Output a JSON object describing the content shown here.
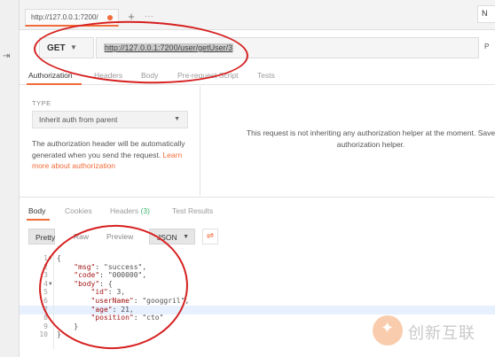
{
  "tabs": {
    "request_tab_label": "http://127.0.0.1:7200/",
    "new_tab": "+",
    "more": "···",
    "env_label": "N"
  },
  "request": {
    "method": "GET",
    "url": "http://127.0.0.1:7200/user/getUser/3",
    "params_label": "P"
  },
  "request_tabs": [
    "Authorization",
    "Headers",
    "Body",
    "Pre-request Script",
    "Tests"
  ],
  "auth": {
    "type_label": "TYPE",
    "type_value": "Inherit auth from parent",
    "description": "The authorization header will be automatically generated when you send the request. ",
    "learn_more": "Learn more about authorization",
    "message": "This request is not inheriting any authorization helper at the moment. Save authorization helper."
  },
  "response_tabs": {
    "body": "Body",
    "cookies": "Cookies",
    "headers": "Headers",
    "headers_count": "(3)",
    "test_results": "Test Results"
  },
  "view_modes": {
    "pretty": "Pretty",
    "raw": "Raw",
    "preview": "Preview",
    "format": "JSON"
  },
  "response_lines": [
    {
      "n": "1",
      "fold": true,
      "text": "{"
    },
    {
      "n": "2",
      "fold": false,
      "text": "    \"msg\": \"success\","
    },
    {
      "n": "3",
      "fold": false,
      "text": "    \"code\": \"000000\","
    },
    {
      "n": "4",
      "fold": true,
      "text": "    \"body\": {"
    },
    {
      "n": "5",
      "fold": false,
      "text": "        \"id\": 3,"
    },
    {
      "n": "6",
      "fold": false,
      "text": "        \"userName\": \"googgril\","
    },
    {
      "n": "7",
      "fold": false,
      "text": "        \"age\": 21,"
    },
    {
      "n": "8",
      "fold": false,
      "text": "        \"position\": \"cto\""
    },
    {
      "n": "9",
      "fold": false,
      "text": "    }"
    },
    {
      "n": "10",
      "fold": false,
      "text": "}"
    }
  ],
  "watermark": {
    "text": "创新互联"
  },
  "colors": {
    "accent": "#f26b3a",
    "annotation": "#d62020",
    "count_green": "#3bb46e"
  }
}
